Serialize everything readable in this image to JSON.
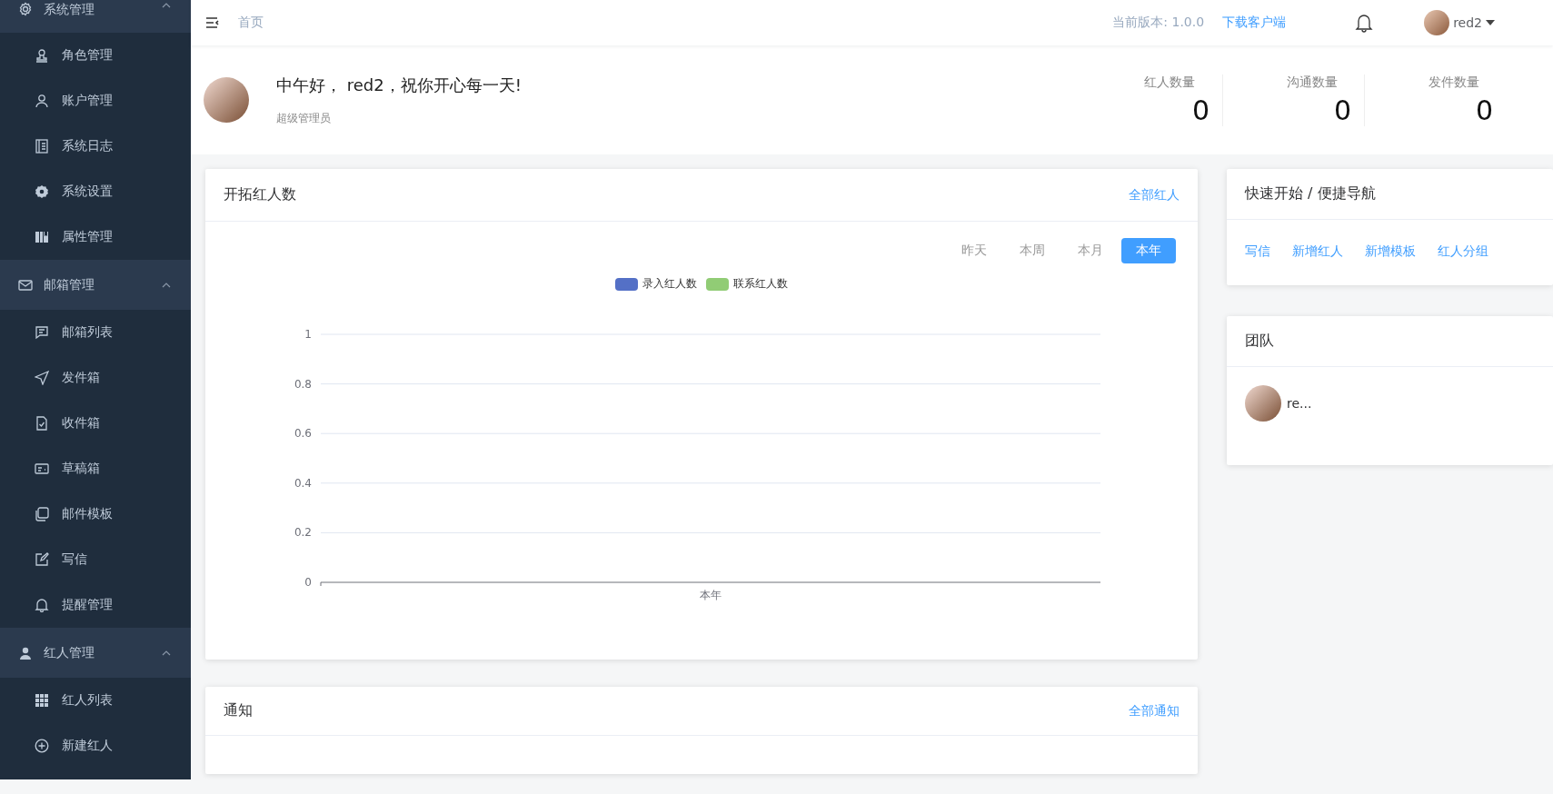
{
  "sidebar": {
    "groups": [
      {
        "label": "系统管理",
        "expanded": true,
        "items": [
          {
            "label": "角色管理",
            "selected": false
          },
          {
            "label": "账户管理",
            "selected": false
          },
          {
            "label": "系统日志",
            "selected": false
          },
          {
            "label": "系统设置",
            "selected": false
          },
          {
            "label": "属性管理",
            "selected": false
          }
        ]
      },
      {
        "label": "邮箱管理",
        "expanded": true,
        "items": [
          {
            "label": "邮箱列表",
            "selected": false
          },
          {
            "label": "发件箱",
            "selected": false
          },
          {
            "label": "收件箱",
            "selected": false
          },
          {
            "label": "草稿箱",
            "selected": false
          },
          {
            "label": "邮件模板",
            "selected": false
          },
          {
            "label": "写信",
            "selected": false
          },
          {
            "label": "提醒管理",
            "selected": false
          }
        ]
      },
      {
        "label": "红人管理",
        "expanded": true,
        "items": [
          {
            "label": "红人列表",
            "selected": false
          },
          {
            "label": "新建红人",
            "selected": false
          }
        ]
      }
    ]
  },
  "header": {
    "breadcrumb": "首页",
    "version": "当前版本: 1.0.0",
    "download_link": "下载客户端",
    "username": "red2"
  },
  "greeting": {
    "message": "中午好， red2，祝你开心每一天!",
    "role": "超级管理员",
    "stats": [
      {
        "label": "红人数量",
        "value": "0"
      },
      {
        "label": "沟通数量",
        "value": "0"
      },
      {
        "label": "发件数量",
        "value": "0"
      }
    ]
  },
  "chart_card": {
    "title": "开拓红人数",
    "link": "全部红人",
    "periods": [
      {
        "label": "昨天",
        "selected": false
      },
      {
        "label": "本周",
        "selected": false
      },
      {
        "label": "本月",
        "selected": false
      },
      {
        "label": "本年",
        "selected": true
      }
    ],
    "chart_data": {
      "type": "bar",
      "categories": [
        "本年"
      ],
      "series": [
        {
          "name": "录入红人数",
          "color": "#5470c6",
          "values": [
            0
          ]
        },
        {
          "name": "联系红人数",
          "color": "#91cc75",
          "values": [
            0
          ]
        }
      ],
      "ylim": [
        0,
        1
      ],
      "grid": true,
      "yticks": [
        0,
        0.2,
        0.4,
        0.6,
        0.8,
        1
      ]
    }
  },
  "quick_start": {
    "title": "快速开始 / 便捷导航",
    "links": [
      "写信",
      "新增红人",
      "新增模板",
      "红人分组"
    ]
  },
  "team": {
    "title": "团队",
    "members": [
      {
        "name": "re..."
      }
    ]
  },
  "notices": {
    "title": "通知",
    "link": "全部通知"
  }
}
